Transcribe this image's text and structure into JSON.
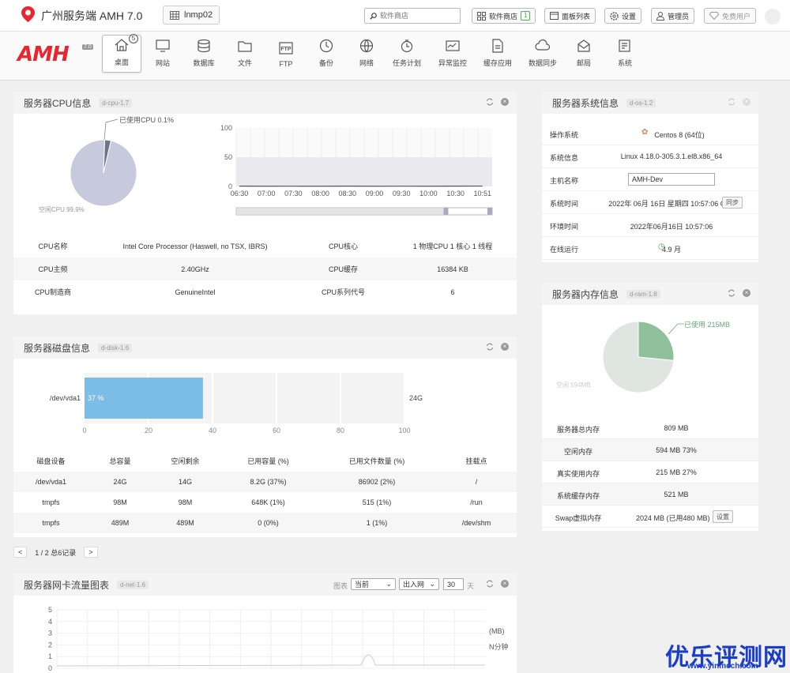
{
  "top": {
    "app_title": "广州服务端 AMH 7.0",
    "server": "lnmp02",
    "search_placeholder": "软件商店",
    "buttons": {
      "store": "软件商店",
      "store_badge": "1",
      "panels": "面板列表",
      "settings": "设置",
      "admin": "管理员",
      "free": "免费用户"
    }
  },
  "nav": {
    "logo": "AMH",
    "version": "7.0",
    "badge": "5",
    "items": [
      "桌面",
      "网站",
      "数据库",
      "文件",
      "FTP",
      "备份",
      "网络",
      "任务计划",
      "异常监控",
      "缓存应用",
      "数据同步",
      "邮局",
      "系统"
    ]
  },
  "cpu": {
    "title": "服务器CPU信息",
    "tag": "d-cpu-1.7",
    "used_label": "已使用CPU 0.1%",
    "free_label": "空闲CPU 99.9%",
    "rows": [
      {
        "k1": "CPU名称",
        "v1": "Intel Core Processor (Haswell, no TSX, IBRS)",
        "k2": "CPU核心",
        "v2": "1 物理CPU   1 核心   1 线程"
      },
      {
        "k1": "CPU主频",
        "v1": "2.40GHz",
        "k2": "CPU缓存",
        "v2": "16384 KB"
      },
      {
        "k1": "CPU制造商",
        "v1": "GenuineIntel",
        "k2": "CPU系列代号",
        "v2": "6"
      }
    ]
  },
  "chart_data": [
    {
      "type": "pie",
      "title": "",
      "slices": [
        {
          "label": "已使用CPU 0.1%",
          "value": 0.1
        },
        {
          "label": "空闲CPU 99.9%",
          "value": 99.9
        }
      ],
      "colors": [
        "#6f7487",
        "#c7c9dc"
      ]
    },
    {
      "type": "line",
      "title": "",
      "x": [
        "06:30",
        "07:00",
        "07:30",
        "08:00",
        "08:30",
        "09:00",
        "09:30",
        "10:00",
        "10:30",
        "10:51"
      ],
      "series": [
        {
          "values": [
            0.5,
            0.3,
            0.4,
            0.3,
            0.5,
            0.3,
            0.4,
            0.3,
            0.5,
            0.6
          ]
        }
      ],
      "yticks": [
        0,
        50,
        100
      ],
      "ylim": [
        0,
        100
      ]
    },
    {
      "type": "bar",
      "title": "",
      "categories": [
        "/dev/vda1"
      ],
      "values": [
        37
      ],
      "value_label": "37 %",
      "right_label": "24G",
      "xticks": [
        0,
        20,
        40,
        60,
        80,
        100
      ],
      "xlim": [
        0,
        100
      ]
    },
    {
      "type": "pie",
      "title": "",
      "slices": [
        {
          "label": "已使用 215MB",
          "value": 215
        },
        {
          "label": "空闲 594MB",
          "value": 594
        }
      ],
      "colors": [
        "#8fbf9b",
        "#dfe5e1"
      ]
    },
    {
      "type": "line",
      "title": "",
      "yticks": [
        0,
        1,
        2,
        3,
        4,
        5
      ],
      "ylim": [
        0,
        5
      ],
      "right_labels": [
        "(MB)",
        "N分钟"
      ]
    }
  ],
  "disk": {
    "title": "服务器磁盘信息",
    "tag": "d-disk-1.6",
    "headers": [
      "磁盘设备",
      "总容量",
      "空闲剩余",
      "已用容量 (%)",
      "已用文件数量 (%)",
      "挂载点"
    ],
    "rows": [
      [
        "/dev/vda1",
        "24G",
        "14G",
        "8.2G (37%)",
        "86902 (2%)",
        "/"
      ],
      [
        "tmpfs",
        "98M",
        "98M",
        "648K (1%)",
        "515 (1%)",
        "/run"
      ],
      [
        "tmpfs",
        "489M",
        "489M",
        "0 (0%)",
        "1 (1%)",
        "/dev/shm"
      ]
    ],
    "pager": "1 / 2 总6记录"
  },
  "net": {
    "title": "服务器网卡流量图表",
    "tag": "d-net-1.6",
    "chart_label": "图表",
    "sel1": "当前",
    "sel2": "出入网",
    "days": "30",
    "days_unit": "天"
  },
  "sys": {
    "title": "服务器系统信息",
    "tag": "d-os-1.2",
    "rows": [
      {
        "k": "操作系统",
        "v": "Centos 8 (64位)"
      },
      {
        "k": "系统信息",
        "v": "Linux 4.18.0-305.3.1.el8.x86_64"
      },
      {
        "k": "主机名称",
        "v": "AMH-Dev"
      },
      {
        "k": "系统时间",
        "v": "2022年 06月 16日 星期四 10:57:06 CST",
        "btn": "同步"
      },
      {
        "k": "环境时间",
        "v": "2022年06月16日 10:57:06"
      },
      {
        "k": "在线运行",
        "v": "4.9 月"
      }
    ]
  },
  "ram": {
    "title": "服务器内存信息",
    "tag": "d-ram-1.8",
    "used_label": "已使用 215MB",
    "free_label": "空闲 594MB",
    "rows": [
      {
        "k": "服务器总内存",
        "v": "809 MB"
      },
      {
        "k": "空闲内存",
        "v": "594 MB   73%"
      },
      {
        "k": "真实使用内存",
        "v": "215 MB   27%"
      },
      {
        "k": "系统缓存内存",
        "v": "521 MB"
      },
      {
        "k": "Swap虚拟内存",
        "v": "2024 MB (已用480 MB)",
        "btn": "设置"
      }
    ]
  },
  "watermark": {
    "main": "优乐评测网",
    "sub": "www.yinmech.com"
  }
}
